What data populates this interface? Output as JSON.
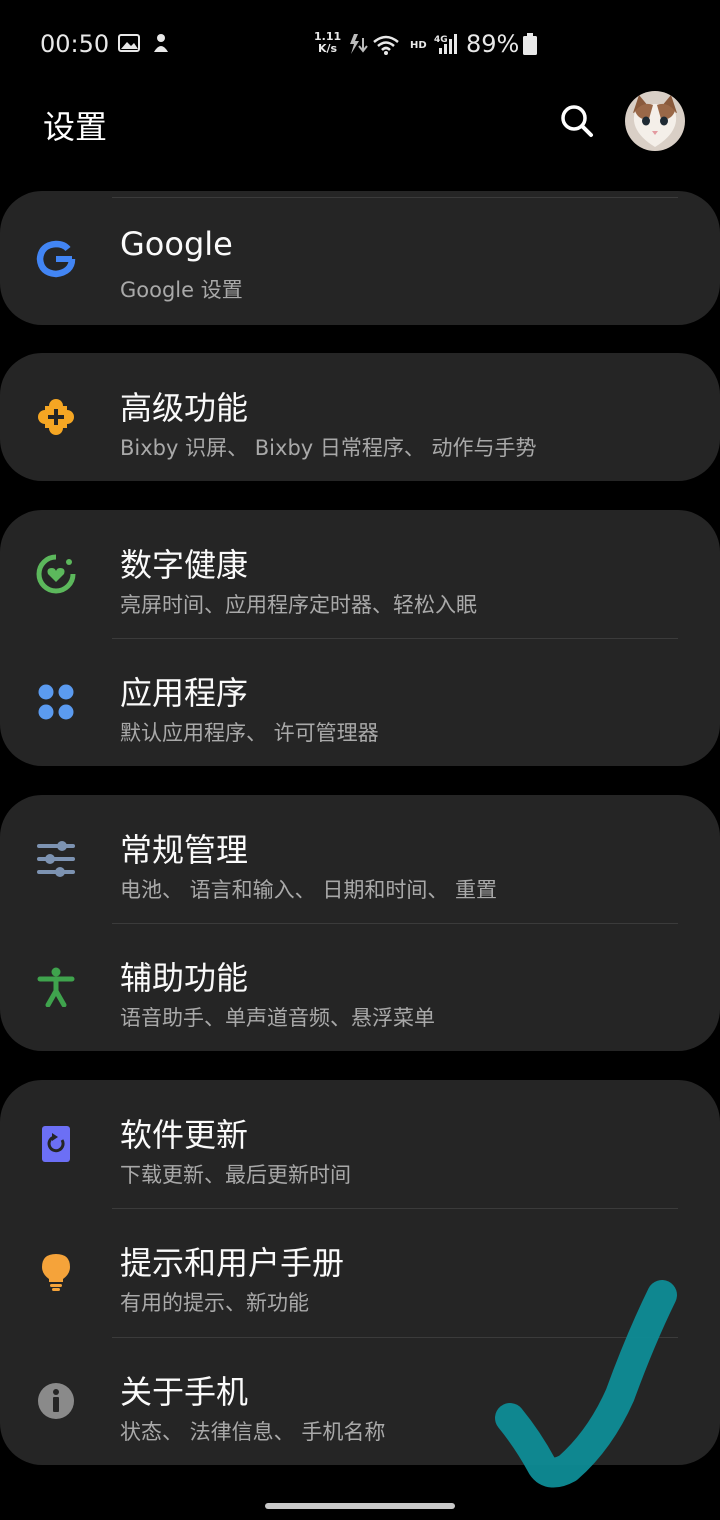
{
  "status_bar": {
    "time": "00:50",
    "net_speed_value": "1.11",
    "net_speed_unit": "K/s",
    "hd_label": "HD",
    "network_label": "4G",
    "battery": "89%"
  },
  "header": {
    "title": "设置"
  },
  "cards": [
    {
      "items": [
        {
          "title": "Google",
          "subtitle": "Google 设置",
          "icon": "google-icon",
          "color": "#4285f4"
        }
      ]
    },
    {
      "items": [
        {
          "title": "高级功能",
          "subtitle": "Bixby 识屏、 Bixby 日常程序、 动作与手势",
          "icon": "advanced-features-icon",
          "color": "#f5a623"
        }
      ]
    },
    {
      "items": [
        {
          "title": "数字健康",
          "subtitle": "亮屏时间、应用程序定时器、轻松入眠",
          "icon": "digital-wellbeing-icon",
          "color": "#5cb85c"
        },
        {
          "title": "应用程序",
          "subtitle": "默认应用程序、 许可管理器",
          "icon": "apps-icon",
          "color": "#5b9bf0"
        }
      ]
    },
    {
      "items": [
        {
          "title": "常规管理",
          "subtitle": "电池、 语言和输入、 日期和时间、 重置",
          "icon": "sliders-icon",
          "color": "#7d93b2"
        },
        {
          "title": "辅助功能",
          "subtitle": "语音助手、单声道音频、悬浮菜单",
          "icon": "accessibility-icon",
          "color": "#3fa34d"
        }
      ]
    },
    {
      "items": [
        {
          "title": "软件更新",
          "subtitle": "下载更新、最后更新时间",
          "icon": "software-update-icon",
          "color": "#6c6ff5"
        },
        {
          "title": "提示和用户手册",
          "subtitle": "有用的提示、新功能",
          "icon": "lightbulb-icon",
          "color": "#f5a33a"
        },
        {
          "title": "关于手机",
          "subtitle": "状态、 法律信息、 手机名称",
          "icon": "info-icon",
          "color": "#8a8a8a"
        }
      ]
    }
  ],
  "annotation": {
    "icon": "checkmark-annotation",
    "color": "#0e8c96"
  }
}
